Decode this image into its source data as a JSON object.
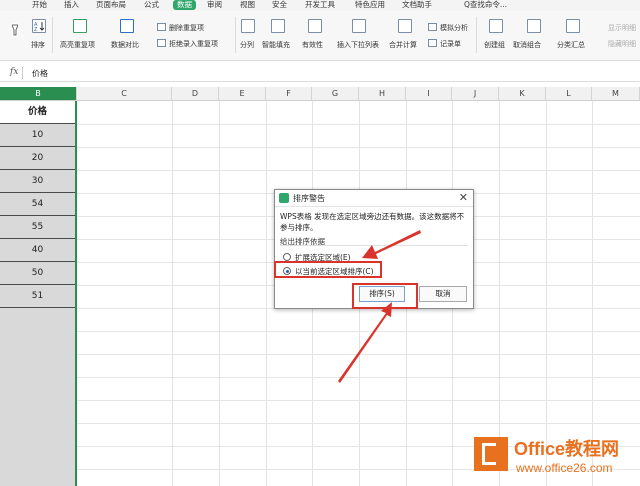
{
  "menu": {
    "items": [
      "开始",
      "插入",
      "页面布局",
      "公式",
      "数据",
      "审阅",
      "视图",
      "安全",
      "开发工具",
      "特色应用",
      "文档助手"
    ],
    "active": "数据",
    "search": "Q查找命令..."
  },
  "ribbon": {
    "sort": "排序",
    "highlight_dup": "高亮重复项",
    "data_compare": "数据对比",
    "delete_dup": "删除重复项",
    "reject_dup": "拒绝录入重复项",
    "split": "分列",
    "smart_fill": "智能填充",
    "validity": "有效性",
    "insert_dropdown": "插入下拉列表",
    "consolidate": "合并计算",
    "simulate": "模拟分析",
    "record_form": "记录单",
    "create_group": "创建组",
    "ungroup": "取消组合",
    "subtotal": "分类汇总",
    "show_detail": "显示明细",
    "hide_detail": "隐藏明细"
  },
  "formula_bar": {
    "fx": "fx",
    "value": "价格"
  },
  "columns": [
    "B",
    "C",
    "D",
    "E",
    "F",
    "G",
    "H",
    "I",
    "J",
    "K",
    "L",
    "M"
  ],
  "column_b": {
    "header": "价格",
    "values": [
      "10",
      "20",
      "30",
      "54",
      "55",
      "40",
      "50",
      "51"
    ]
  },
  "dialog": {
    "title": "排序警告",
    "close": "✕",
    "message": "WPS表格 发现在选定区域旁边还有数据。该这数据将不参与排序。",
    "group_label": "给出排序依据",
    "option_expand": "扩展选定区域(E)",
    "option_current": "以当前选定区域排序(C)",
    "selected_option": "option_current",
    "sort_button": "排序(S)",
    "cancel_button": "取消"
  },
  "watermark": {
    "title": "Office教程网",
    "url": "www.office26.com"
  },
  "colors": {
    "accent_green": "#2fa66b",
    "annotation_red": "#d9342b",
    "watermark_orange": "#e8711f"
  }
}
